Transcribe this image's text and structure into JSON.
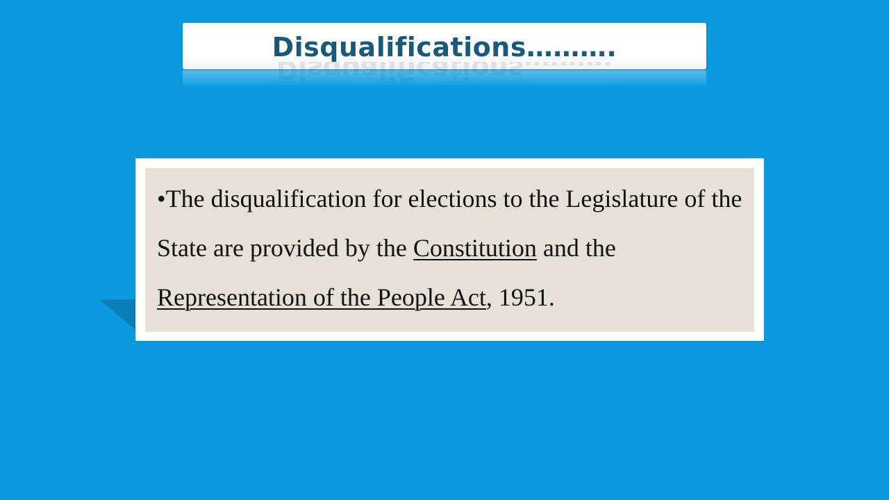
{
  "slide": {
    "title": "Disqualifications……….",
    "body": {
      "bullet": "•",
      "text_part1": "The disqualification for elections to the Legislature of the State are provided by the ",
      "link1": "Constitution",
      "text_part2": " and the ",
      "link2": "Representation of the People Act",
      "text_part3": ", 1951."
    }
  },
  "colors": {
    "background": "#0b9ae0",
    "title_text": "#1a5a78",
    "card_fill": "#e6e0d6",
    "card_border": "#ffffff"
  }
}
